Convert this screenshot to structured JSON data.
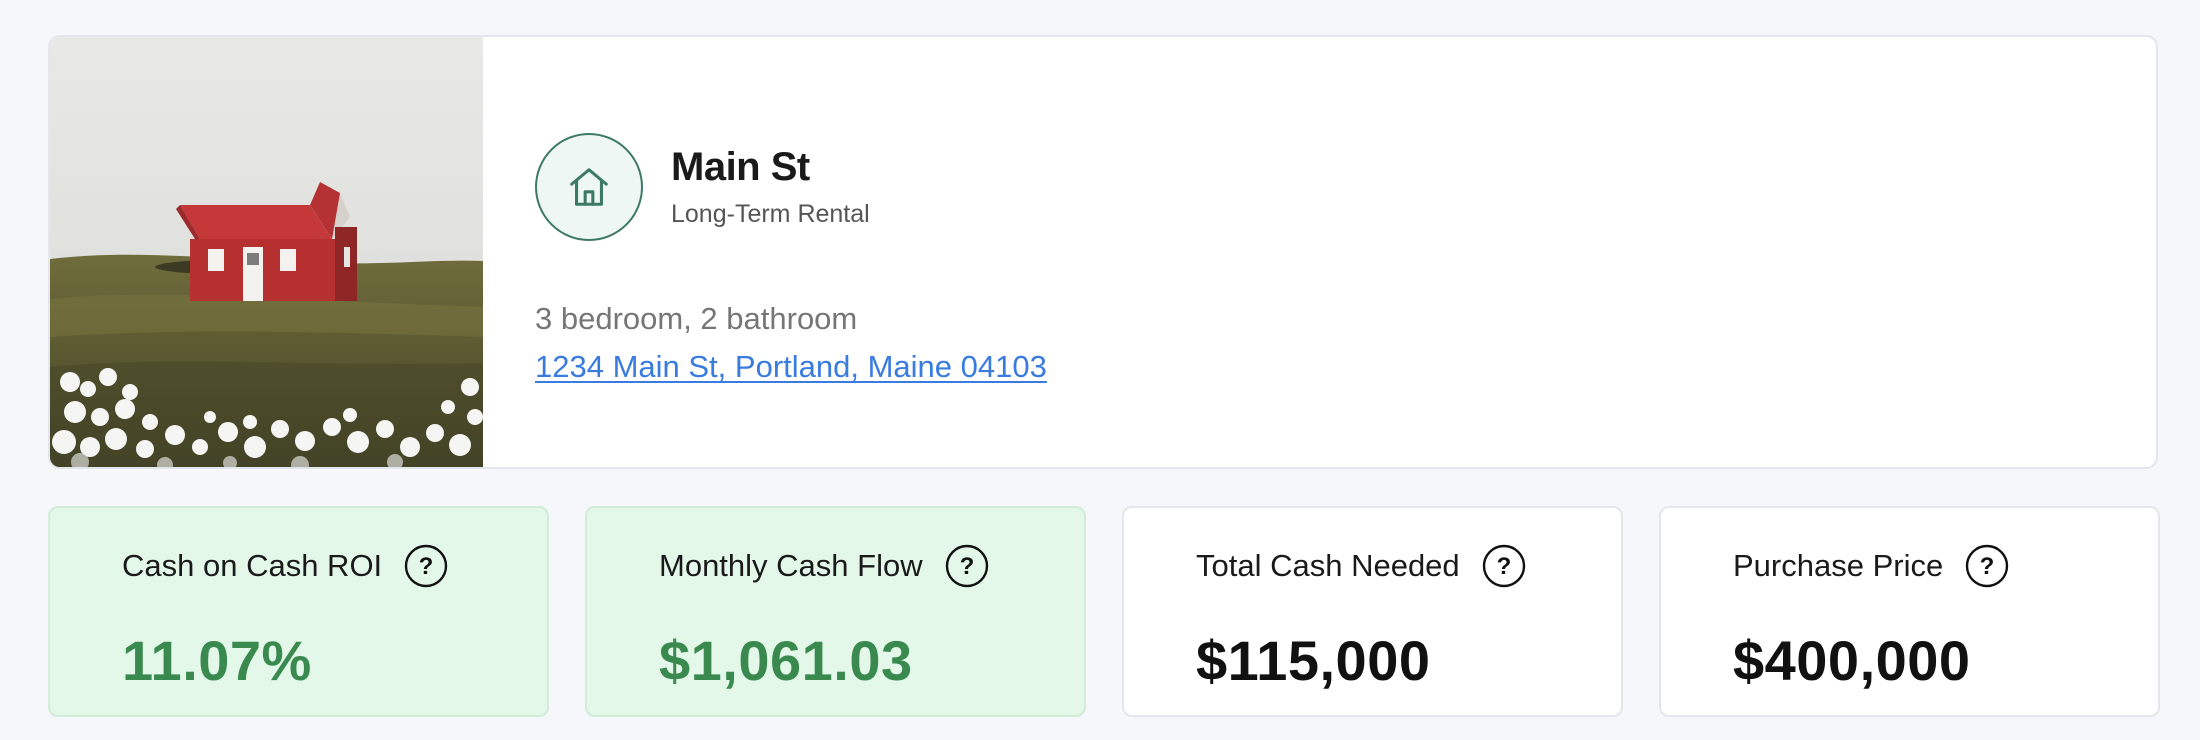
{
  "property": {
    "title": "Main St",
    "type": "Long-Term Rental",
    "bed_bath": "3 bedroom, 2 bathroom",
    "address": "1234 Main St, Portland, Maine 04103",
    "photo_icon": "red-house-on-hill-photo",
    "badge_icon": "house-icon"
  },
  "metrics": [
    {
      "label": "Cash on Cash ROI",
      "value": "11.07%",
      "tone": "positive",
      "icon": "help-circle-icon"
    },
    {
      "label": "Monthly Cash Flow",
      "value": "$1,061.03",
      "tone": "positive",
      "icon": "help-circle-icon"
    },
    {
      "label": "Total Cash Needed",
      "value": "$115,000",
      "tone": "neutral",
      "icon": "help-circle-icon"
    },
    {
      "label": "Purchase Price",
      "value": "$400,000",
      "tone": "neutral",
      "icon": "help-circle-icon"
    }
  ],
  "colors": {
    "accent_green": "#3a8a4f",
    "positive_bg": "#e4f8ea",
    "link_blue": "#3a7be0",
    "badge_stroke": "#3d7a66"
  }
}
